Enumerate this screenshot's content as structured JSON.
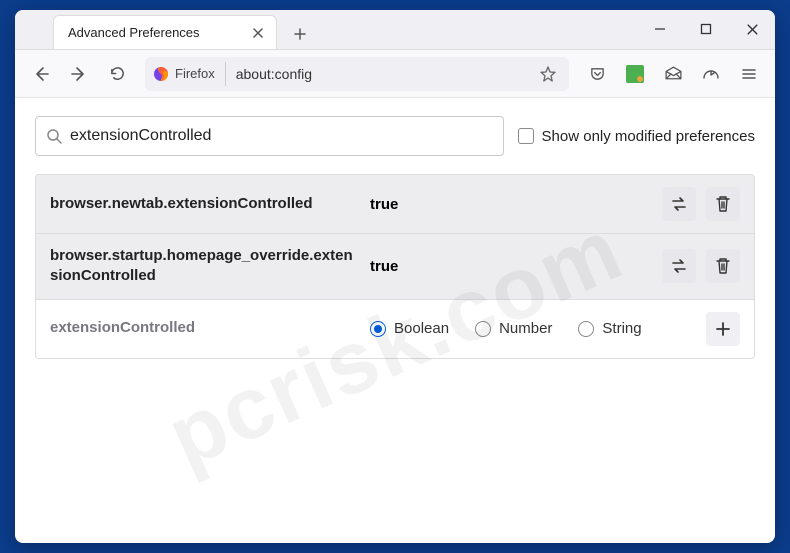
{
  "window": {
    "tab_title": "Advanced Preferences"
  },
  "toolbar": {
    "identity_label": "Firefox",
    "url": "about:config"
  },
  "search": {
    "value": "extensionControlled",
    "placeholder": "",
    "modified_only_label": "Show only modified preferences"
  },
  "prefs": [
    {
      "name": "browser.newtab.extensionControlled",
      "value": "true",
      "modified": true
    },
    {
      "name": "browser.startup.homepage_override.extensionControlled",
      "value": "true",
      "modified": true
    }
  ],
  "new_pref": {
    "name": "extensionControlled",
    "types": [
      "Boolean",
      "Number",
      "String"
    ],
    "selected_type": "Boolean"
  },
  "watermark": "pcrisk.com"
}
